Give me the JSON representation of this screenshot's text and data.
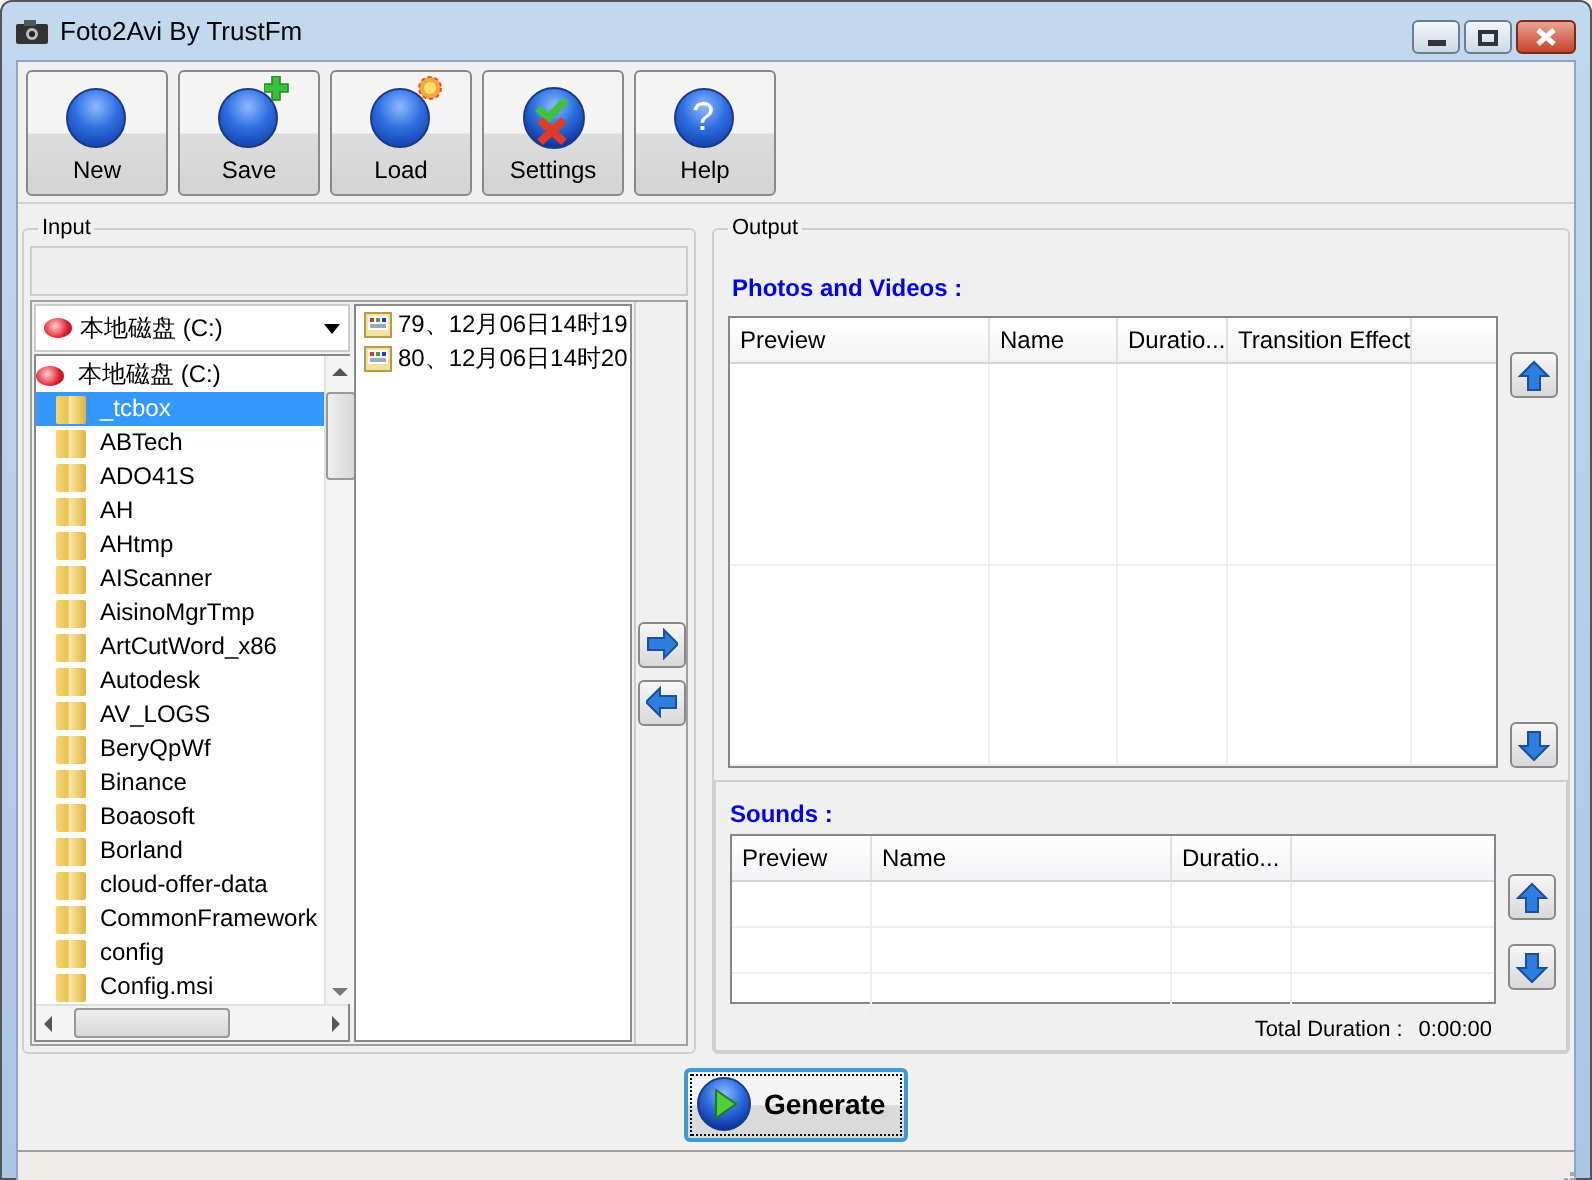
{
  "window": {
    "title": "Foto2Avi By TrustFm"
  },
  "toolbar": [
    {
      "kind": "new",
      "label": "New"
    },
    {
      "kind": "save",
      "label": "Save"
    },
    {
      "kind": "load",
      "label": "Load"
    },
    {
      "kind": "settings",
      "label": "Settings"
    },
    {
      "kind": "help",
      "label": "Help",
      "glyph": "?"
    }
  ],
  "input": {
    "legend": "Input",
    "drive_combo": {
      "value": "本地磁盘 (C:)"
    },
    "tree": [
      {
        "label": "本地磁盘 (C:)",
        "selected": false,
        "children": [
          {
            "label": "_tcbox",
            "selected": true
          },
          {
            "label": "ABTech",
            "selected": false
          },
          {
            "label": "ADO41S",
            "selected": false
          },
          {
            "label": "AH",
            "selected": false
          },
          {
            "label": "AHtmp",
            "selected": false
          },
          {
            "label": "AIScanner",
            "selected": false
          },
          {
            "label": "AisinoMgrTmp",
            "selected": false
          },
          {
            "label": "ArtCutWord_x86",
            "selected": false
          },
          {
            "label": "Autodesk",
            "selected": false
          },
          {
            "label": "AV_LOGS",
            "selected": false
          },
          {
            "label": "BeryQpWf",
            "selected": false
          },
          {
            "label": "Binance",
            "selected": false
          },
          {
            "label": "Boaosoft",
            "selected": false
          },
          {
            "label": "Borland",
            "selected": false
          },
          {
            "label": "cloud-offer-data",
            "selected": false
          },
          {
            "label": "CommonFramework",
            "selected": false
          },
          {
            "label": "config",
            "selected": false
          },
          {
            "label": "Config.msi",
            "selected": false
          }
        ]
      }
    ],
    "files": [
      "79、12月06日14时19",
      "80、12月06日14时20"
    ]
  },
  "output": {
    "legend": "Output",
    "photos": {
      "title": "Photos and Videos :",
      "columns": [
        "Preview",
        "Name",
        "Duratio...",
        "Transition Effect"
      ]
    },
    "sounds": {
      "title": "Sounds :",
      "columns": [
        "Preview",
        "Name",
        "Duratio..."
      ]
    },
    "total_duration": {
      "label": "Total Duration :",
      "value": "0:00:00"
    }
  },
  "generate": {
    "label": "Generate"
  }
}
